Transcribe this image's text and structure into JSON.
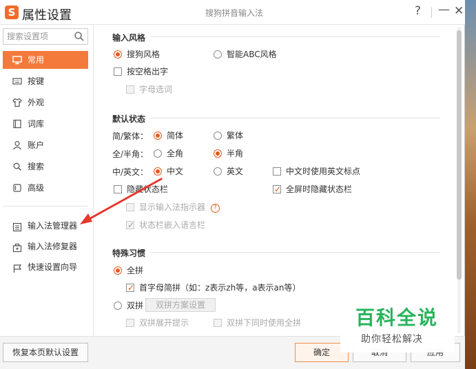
{
  "window": {
    "title": "属性设置",
    "app_name": "搜狗拼音输入法",
    "logo_letter": "S",
    "help_label": "?",
    "minimize_label": "—",
    "close_label": "✕"
  },
  "sidebar": {
    "search_placeholder": "搜索设置项",
    "items": [
      {
        "label": "常用",
        "icon": "monitor-icon",
        "active": true
      },
      {
        "label": "按键",
        "icon": "keyboard-icon"
      },
      {
        "label": "外观",
        "icon": "shirt-icon"
      },
      {
        "label": "词库",
        "icon": "book-icon"
      },
      {
        "label": "账户",
        "icon": "user-icon"
      },
      {
        "label": "搜索",
        "icon": "search-icon"
      },
      {
        "label": "高级",
        "icon": "square-icon"
      }
    ],
    "tools": [
      {
        "label": "输入法管理器",
        "icon": "list-icon"
      },
      {
        "label": "输入法修复器",
        "icon": "toolbox-icon"
      },
      {
        "label": "快速设置向导",
        "icon": "flag-icon"
      }
    ]
  },
  "content": {
    "input_style": {
      "title": "输入风格",
      "options": [
        {
          "label": "搜狗风格",
          "selected": true
        },
        {
          "label": "智能ABC风格",
          "selected": false
        }
      ],
      "space_output": {
        "label": "按空格出字",
        "checked": false
      },
      "letter_select": {
        "label": "字母选词",
        "checked": false
      }
    },
    "default_state": {
      "title": "默认状态",
      "script_label": "简/繁体：",
      "script_options": [
        "简体",
        "繁体"
      ],
      "width_label": "全/半角：",
      "width_options": [
        "全角",
        "半角"
      ],
      "lang_label": "中/英文：",
      "lang_options": [
        "中文",
        "英文"
      ],
      "cn_punct": "中文时使用英文标点",
      "hide_status": "隐藏状态栏",
      "fullscreen_hide": "全屏时隐藏状态栏",
      "show_indicator": "显示输入法指示器",
      "help_icon_label": "?",
      "embed_lang_bar": "状态栏嵌入语言栏"
    },
    "special_habits": {
      "title": "特殊习惯",
      "full_pinyin": "全拼",
      "initial_abbrev": "首字母简拼（如：z表示zh等，a表示an等）",
      "double_pinyin": "双拼",
      "double_scheme_btn": "双拼方案设置",
      "double_expand_hint": "双拼展开提示",
      "double_with_full": "双拼下同时使用全拼"
    }
  },
  "footer": {
    "restore": "恢复本页默认设置",
    "ok": "确定",
    "cancel": "取消",
    "apply": "应用"
  },
  "watermark": {
    "title": "百科全说",
    "subtitle": "助你轻松解决"
  },
  "colors": {
    "accent": "#f47a3b",
    "radio_on": "#e35a1c",
    "watermark_green": "#27b45b",
    "arrow_red": "#e5372b"
  }
}
